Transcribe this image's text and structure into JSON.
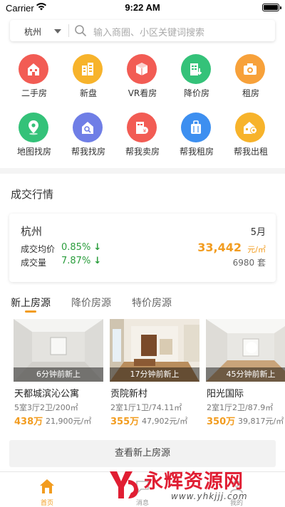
{
  "status": {
    "carrier": "Carrier",
    "time": "9:22 AM"
  },
  "search": {
    "city": "杭州",
    "placeholder": "输入商圈、小区关键词搜索"
  },
  "grid": [
    {
      "label": "二手房",
      "icon": "building-icon",
      "color": "#f25c54"
    },
    {
      "label": "新盘",
      "icon": "new-house-icon",
      "color": "#f7b32b"
    },
    {
      "label": "VR看房",
      "icon": "vr-box-icon",
      "color": "#f25c54"
    },
    {
      "label": "降价房",
      "icon": "price-down-icon",
      "color": "#34c279"
    },
    {
      "label": "租房",
      "icon": "camera-icon",
      "color": "#f7a13a"
    },
    {
      "label": "地图找房",
      "icon": "map-pin-icon",
      "color": "#34c279"
    },
    {
      "label": "帮我找房",
      "icon": "house-search-icon",
      "color": "#6f7ee6"
    },
    {
      "label": "帮我卖房",
      "icon": "sell-house-icon",
      "color": "#f25c54"
    },
    {
      "label": "帮我租房",
      "icon": "suitcase-icon",
      "color": "#3d8ff0"
    },
    {
      "label": "帮我出租",
      "icon": "rent-out-icon",
      "color": "#f7b32b"
    }
  ],
  "market": {
    "title": "成交行情",
    "city": "杭州",
    "month": "5月",
    "avg_label": "成交均价",
    "avg_change": "0.85%",
    "vol_label": "成交量",
    "vol_change": "7.87%",
    "price": "33,442",
    "price_unit": "元/㎡",
    "deals": "6980 套"
  },
  "tabs": [
    "新上房源",
    "降价房源",
    "特价房源"
  ],
  "listings": [
    {
      "tag": "6分钟前新上",
      "name": "天都城滨沁公寓",
      "spec": "5室3厅2卫/200㎡",
      "price": "438万",
      "unit_price": "21,900元/㎡"
    },
    {
      "tag": "17分钟前新上",
      "name": "贡院新村",
      "spec": "2室1厅1卫/74.11㎡",
      "price": "355万",
      "unit_price": "47,902元/㎡"
    },
    {
      "tag": "45分钟前新上",
      "name": "阳光国际",
      "spec": "2室1厅2卫/87.9㎡",
      "price": "350万",
      "unit_price": "39,817元/㎡"
    }
  ],
  "more_button": "查看新上房源",
  "tabbar": [
    {
      "label": "首页",
      "icon": "home-icon"
    },
    {
      "label": "消息",
      "icon": "message-icon"
    },
    {
      "label": "我的",
      "icon": "user-icon"
    }
  ],
  "watermark": {
    "title": "永辉资源网",
    "url": "www.yhkjjj.com"
  }
}
